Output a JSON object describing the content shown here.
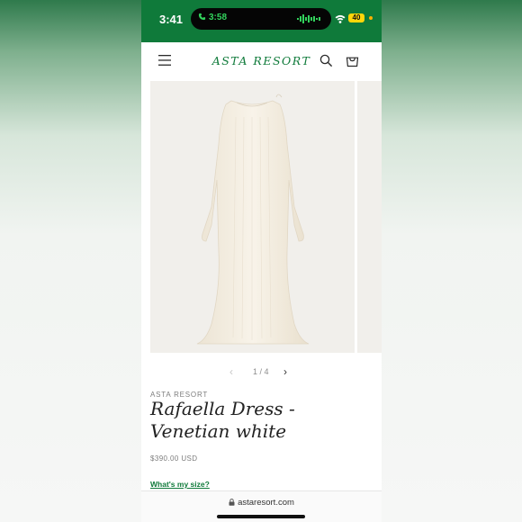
{
  "status": {
    "time": "3:41",
    "call_time": "3:58",
    "battery": "40"
  },
  "header": {
    "logo": "ASTA RESORT",
    "icons": [
      "menu-icon",
      "search-icon",
      "cart-icon"
    ]
  },
  "gallery": {
    "counter": "1 / 4",
    "prev_icon": "‹",
    "next_icon": "›"
  },
  "product": {
    "vendor": "ASTA RESORT",
    "title": "Rafaella Dress - Venetian white",
    "price": "$390.00 USD",
    "size_link": "What's my size?"
  },
  "browser": {
    "url": "astaresort.com"
  },
  "colors": {
    "brand_green": "#0f7a3a",
    "image_bg": "#f1efeb",
    "dress": "#f6f0e4"
  }
}
